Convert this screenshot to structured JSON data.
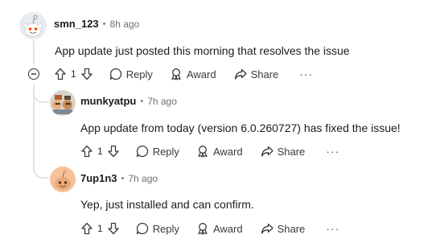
{
  "comments": [
    {
      "username": "smn_123",
      "separator": "•",
      "time": "8h ago",
      "text": "App update just posted this morning that resolves the issue",
      "votes": "1",
      "actions": {
        "reply": "Reply",
        "award": "Award",
        "share": "Share",
        "more": "···"
      }
    },
    {
      "username": "munkyatpu",
      "separator": "•",
      "time": "7h ago",
      "text": "App update from today (version 6.0.260727) has fixed the issue!",
      "votes": "1",
      "actions": {
        "reply": "Reply",
        "award": "Award",
        "share": "Share",
        "more": "···"
      }
    },
    {
      "username": "7up1n3",
      "separator": "•",
      "time": "7h ago",
      "text": "Yep, just installed and can confirm.",
      "votes": "1",
      "actions": {
        "reply": "Reply",
        "award": "Award",
        "share": "Share",
        "more": "···"
      }
    }
  ]
}
